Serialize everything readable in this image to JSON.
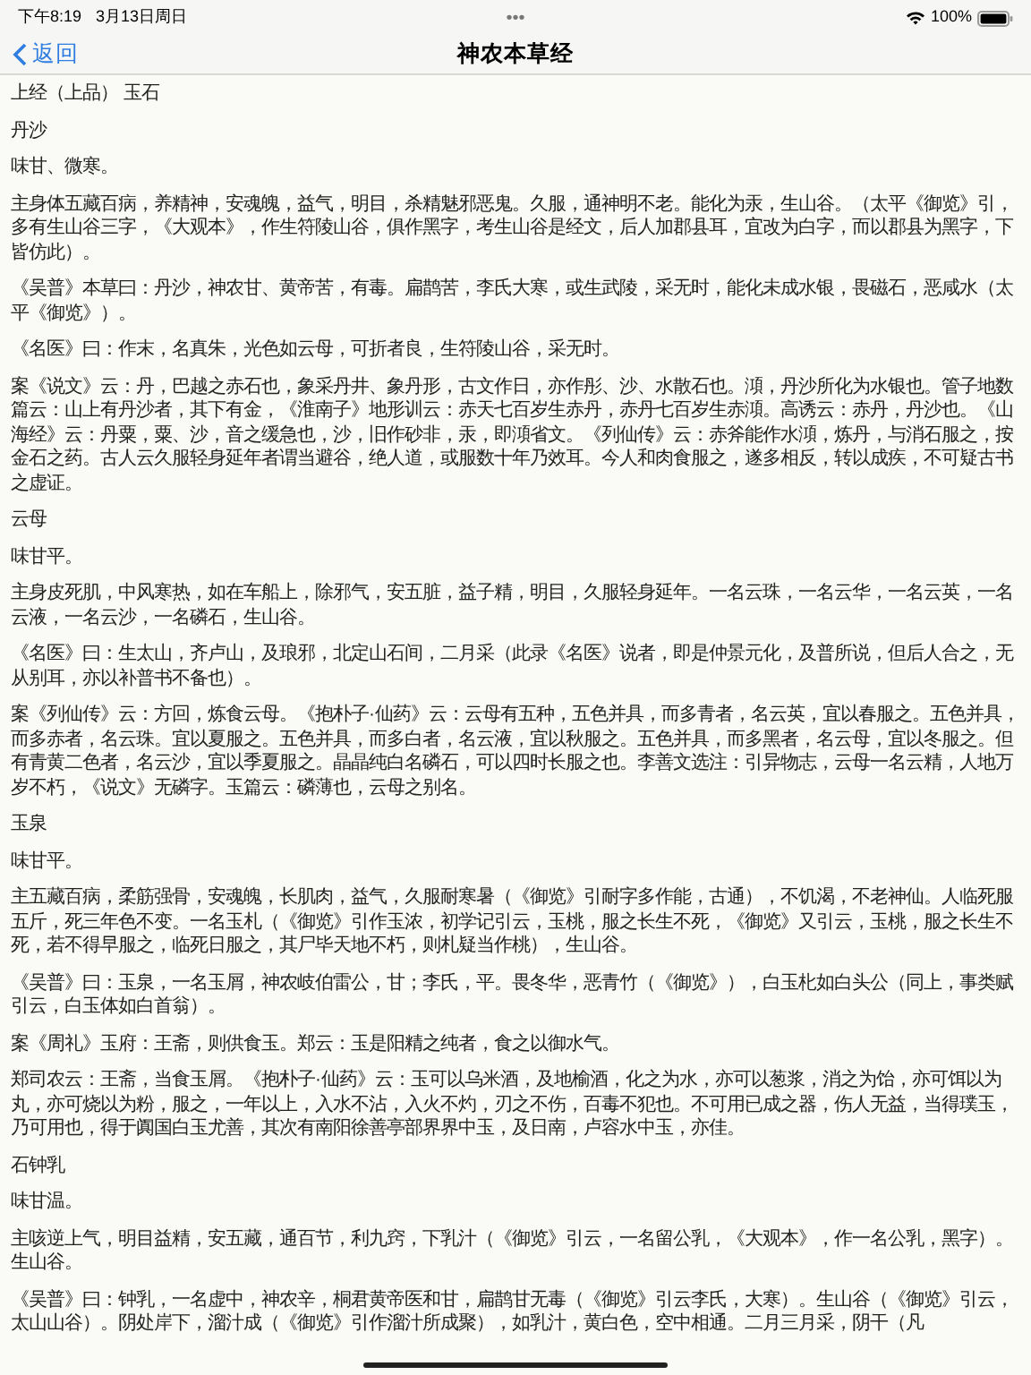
{
  "status_bar": {
    "time": "下午8:19",
    "date": "3月13日周日",
    "dots": "•••",
    "battery": "100%"
  },
  "nav": {
    "back": "返回",
    "title": "神农本草经"
  },
  "paragraphs": [
    "上经（上品） 玉石",
    "丹沙",
    "味甘、微寒。",
    "主身体五藏百病，养精神，安魂魄，益气，明目，杀精魅邪恶鬼。久服，通神明不老。能化为汞，生山谷。（太平《御览》引，多有生山谷三字，《大观本》，作生符陵山谷，俱作黑字，考生山谷是经文，后人加郡县耳，宜改为白字，而以郡县为黑字，下皆仿此）。",
    "《吴普》本草曰：丹沙，神农甘、黄帝苦，有毒。扁鹊苦，李氏大寒，或生武陵，采无时，能化未成水银，畏磁石，恶咸水（太平《御览》）。",
    "《名医》曰：作末，名真朱，光色如云母，可折者良，生符陵山谷，采无时。",
    "案《说文》云：丹，巴越之赤石也，象采丹井、象丹形，古文作日，亦作彤、沙、水散石也。澒，丹沙所化为水银也。管子地数篇云：山上有丹沙者，其下有金，《淮南子》地形训云：赤天七百岁生赤丹，赤丹七百岁生赤澒。高诱云：赤丹，丹沙也。《山海经》云：丹粟，粟、沙，音之缓急也，沙，旧作砂非，汞，即澒省文。《列仙传》云：赤斧能作水澒，炼丹，与消石服之，按金石之药。古人云久服轻身延年者谓当避谷，绝人道，或服数十年乃效耳。今人和肉食服之，遂多相反，转以成疾，不可疑古书之虚证。",
    "云母",
    "味甘平。",
    "主身皮死肌，中风寒热，如在车船上，除邪气，安五脏，益子精，明目，久服轻身延年。一名云珠，一名云华，一名云英，一名云液，一名云沙，一名磷石，生山谷。",
    "《名医》曰：生太山，齐卢山，及琅邪，北定山石间，二月采（此录《名医》说者，即是仲景元化，及普所说，但后人合之，无从别耳，亦以补普书不备也）。",
    "案《列仙传》云：方回，炼食云母。《抱朴子·仙药》云：云母有五种，五色并具，而多青者，名云英，宜以春服之。五色并具，而多赤者，名云珠。宜以夏服之。五色并具，而多白者，名云液，宜以秋服之。五色并具，而多黑者，名云母，宜以冬服之。但有青黄二色者，名云沙，宜以季夏服之。晶晶纯白名磷石，可以四时长服之也。李善文选注：引异物志，云母一名云精，人地万岁不朽，《说文》无磷字。玉篇云：磷薄也，云母之别名。",
    "玉泉",
    "味甘平。",
    "主五藏百病，柔筋强骨，安魂魄，长肌肉，益气，久服耐寒暑（《御览》引耐字多作能，古通），不饥渴，不老神仙。人临死服五斤，死三年色不变。一名玉札（《御览》引作玉浓，初学记引云，玉桃，服之长生不死，《御览》又引云，玉桃，服之长生不死，若不得早服之，临死日服之，其尸毕天地不朽，则札疑当作桃），生山谷。",
    "《吴普》曰：玉泉，一名玉屑，神农岐伯雷公，甘；李氏，平。畏冬华，恶青竹（《御览》），白玉朼如白头公（同上，事类赋引云，白玉体如白首翁）。",
    "案《周礼》玉府：王斋，则供食玉。郑云：玉是阳精之纯者，食之以御水气。",
    "郑司农云：王斋，当食玉屑。《抱朴子·仙药》云：玉可以乌米酒，及地榆酒，化之为水，亦可以葱浆，消之为饴，亦可饵以为丸，亦可烧以为粉，服之，一年以上，入水不沾，入火不灼，刃之不伤，百毒不犯也。不可用已成之器，伤人无益，当得璞玉，乃可用也，得于阗国白玉尤善，其次有南阳徐善亭部界界中玉，及日南，卢容水中玉，亦佳。",
    "石钟乳",
    "味甘温。",
    "主咳逆上气，明目益精，安五藏，通百节，利九窍，下乳汁（《御览》引云，一名留公乳，《大观本》，作一名公乳，黑字）。生山谷。",
    "《吴普》曰：钟乳，一名虚中，神农辛，桐君黄帝医和甘，扁鹊甘无毒（《御览》引云李氏，大寒）。生山谷（《御览》引云，太山山谷）。阴处岸下，溜汁成（《御览》引作溜汁所成聚），如乳汁，黄白色，空中相通。二月三月采，阴干（凡"
  ]
}
